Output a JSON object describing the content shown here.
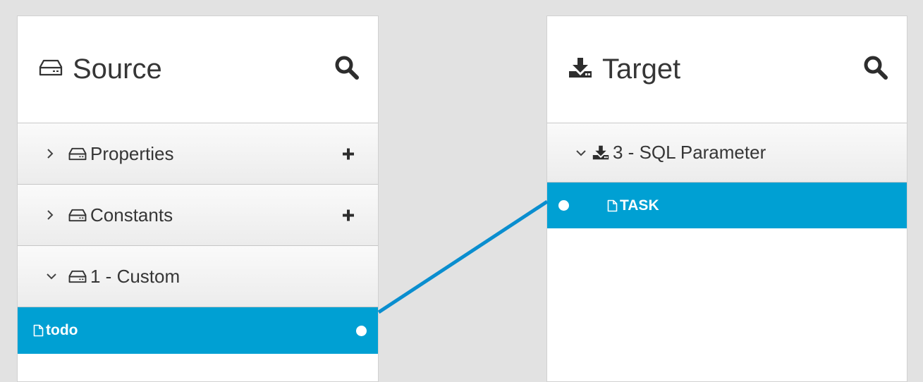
{
  "source": {
    "title": "Source",
    "groups": [
      {
        "label": "Properties",
        "expanded": false
      },
      {
        "label": "Constants",
        "expanded": false
      },
      {
        "label": "1 - Custom",
        "expanded": true
      }
    ],
    "fields": [
      {
        "label": "todo",
        "selected": true
      }
    ]
  },
  "target": {
    "title": "Target",
    "groups": [
      {
        "label": "3 - SQL Parameter",
        "expanded": true
      }
    ],
    "fields": [
      {
        "label": "TASK",
        "selected": true
      }
    ]
  },
  "mapping": {
    "from": "todo",
    "to": "TASK"
  },
  "colors": {
    "selection": "#00a0d3",
    "line": "#0a8ecf",
    "background": "#e2e2e2"
  },
  "icons": [
    "hard-drive-icon",
    "download-icon",
    "search-icon",
    "chevron-right-icon",
    "chevron-down-icon",
    "plus-icon",
    "file-icon"
  ]
}
